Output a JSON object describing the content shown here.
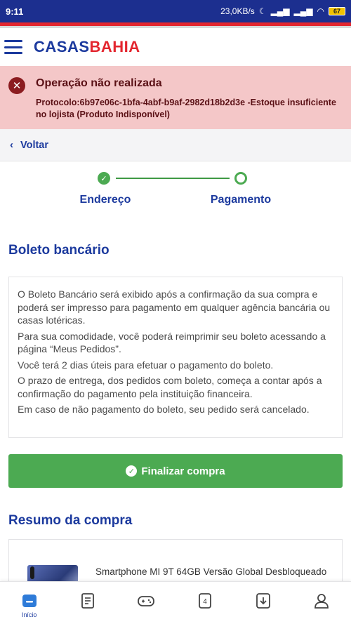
{
  "status_bar": {
    "time": "9:11",
    "speed": "23,0KB/s",
    "battery": "67"
  },
  "header": {
    "logo_casas": "CASAS",
    "logo_bahia": "BAHIA"
  },
  "error": {
    "title": "Operação não realizada",
    "message": "Protocolo:6b97e06c-1bfa-4abf-b9af-2982d18b2d3e -Estoque insuficiente no lojista (Produto Indisponível)"
  },
  "back": {
    "label": "Voltar"
  },
  "stepper": {
    "steps": [
      {
        "label": "Endereço",
        "status": "done"
      },
      {
        "label": "Pagamento",
        "status": "current"
      }
    ]
  },
  "boleto": {
    "title": "Boleto bancário",
    "paragraphs": [
      "O Boleto Bancário será exibido após a confirmação da sua compra e poderá ser impresso para pagamento em qualquer agência bancária ou casas lotéricas.",
      "Para sua comodidade, você poderá reimprimir seu boleto acessando a página “Meus Pedidos”.",
      "Você terá 2 dias úteis para efetuar o pagamento do boleto.",
      "O prazo de entrega, dos pedidos com boleto, começa a contar após a confirmação do pagamento pela instituição financeira.",
      "Em caso de não pagamento do boleto, seu pedido será cancelado."
    ]
  },
  "finalize": {
    "label": "Finalizar compra"
  },
  "resumo": {
    "title": "Resumo da compra",
    "product_name": "Smartphone MI 9T 64GB Versão Global Desbloqueado"
  },
  "bottom_nav": {
    "home_label": "Início",
    "cart_count": "4"
  },
  "colors": {
    "brand_blue": "#1c3a9e",
    "brand_red": "#e3262f",
    "success_green": "#4caa52",
    "error_bg": "#f4c7c8"
  }
}
